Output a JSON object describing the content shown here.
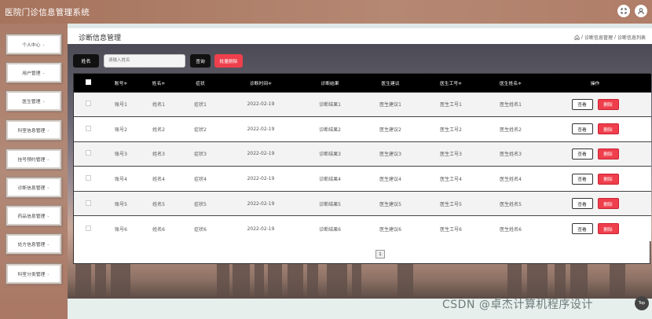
{
  "app": {
    "title": "医院门诊信息管理系统"
  },
  "sidebar": {
    "items": [
      {
        "label": "个人中心"
      },
      {
        "label": "用户管理"
      },
      {
        "label": "医生管理"
      },
      {
        "label": "科室信息管理"
      },
      {
        "label": "挂号预约管理"
      },
      {
        "label": "诊断信息管理"
      },
      {
        "label": "药品信息管理"
      },
      {
        "label": "处方信息管理"
      },
      {
        "label": "科室分类管理"
      }
    ],
    "arrow": "⌄"
  },
  "page": {
    "title": "诊断信息管理",
    "breadcrumb": {
      "sep1": "/",
      "item1": "诊断信息管理",
      "sep2": "/",
      "item2": "诊断信息列表"
    }
  },
  "search": {
    "label": "姓名",
    "placeholder": "请输入姓名",
    "query_button": "查询",
    "batch_delete_button": "批量删除"
  },
  "table": {
    "columns": [
      "账号≑",
      "姓名≑",
      "症状",
      "诊断时间≑",
      "诊断结果",
      "医生建议",
      "医生工号≑",
      "医生姓名≑",
      "操作"
    ],
    "rows": [
      [
        "账号1",
        "姓名1",
        "症状1",
        "2022-02-19",
        "诊断结果1",
        "医生建议1",
        "医生工号1",
        "医生姓名1"
      ],
      [
        "账号2",
        "姓名2",
        "症状2",
        "2022-02-19",
        "诊断结果2",
        "医生建议2",
        "医生工号2",
        "医生姓名2"
      ],
      [
        "账号3",
        "姓名3",
        "症状3",
        "2022-02-19",
        "诊断结果3",
        "医生建议3",
        "医生工号3",
        "医生姓名3"
      ],
      [
        "账号4",
        "姓名4",
        "症状4",
        "2022-02-19",
        "诊断结果4",
        "医生建议4",
        "医生工号4",
        "医生姓名4"
      ],
      [
        "账号5",
        "姓名5",
        "症状5",
        "2022-02-19",
        "诊断结果5",
        "医生建议5",
        "医生工号5",
        "医生姓名5"
      ],
      [
        "账号6",
        "姓名6",
        "症状6",
        "2022-02-19",
        "诊断结果6",
        "医生建议6",
        "医生工号6",
        "医生姓名6"
      ]
    ],
    "view_label": "查看",
    "delete_label": "删除"
  },
  "pagination": {
    "current": "1"
  },
  "watermark": "CSDN @卓杰计算机程序设计",
  "back_to_top": "Top",
  "colors": {
    "danger": "#ef3f4c",
    "dark": "#111111",
    "brand": "#b58873"
  },
  "icons": {
    "fullscreen": "fullscreen-exit-icon",
    "user": "user-icon",
    "home": "home-icon"
  }
}
